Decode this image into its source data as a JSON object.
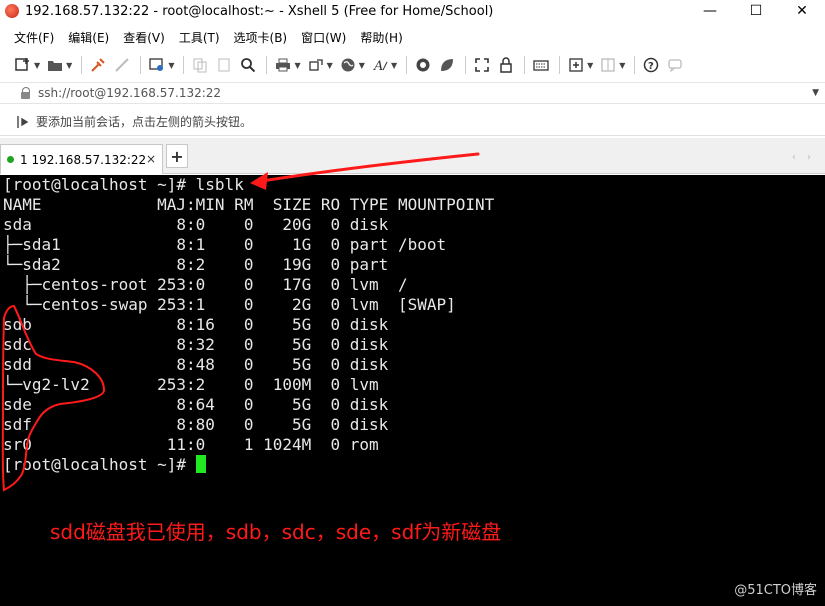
{
  "window": {
    "title": "192.168.57.132:22 - root@localhost:~ - Xshell 5 (Free for Home/School)",
    "minimize": "—",
    "maximize": "☐",
    "close": "✕"
  },
  "menu": {
    "items": [
      "文件(F)",
      "编辑(E)",
      "查看(V)",
      "工具(T)",
      "选项卡(B)",
      "窗口(W)",
      "帮助(H)"
    ]
  },
  "address": {
    "text": "ssh://root@192.168.57.132:22"
  },
  "hint": {
    "text": "要添加当前会话，点击左侧的箭头按钮。"
  },
  "tabs": {
    "active_label": "1 192.168.57.132:22",
    "close": "×",
    "add": "+",
    "nav": "‹ ›"
  },
  "terminal": {
    "lines": [
      "[root@localhost ~]# lsblk",
      "NAME            MAJ:MIN RM  SIZE RO TYPE MOUNTPOINT",
      "sda               8:0    0   20G  0 disk",
      "├─sda1            8:1    0    1G  0 part /boot",
      "└─sda2            8:2    0   19G  0 part",
      "  ├─centos-root 253:0    0   17G  0 lvm  /",
      "  └─centos-swap 253:1    0    2G  0 lvm  [SWAP]",
      "sdb               8:16   0    5G  0 disk",
      "sdc               8:32   0    5G  0 disk",
      "sdd               8:48   0    5G  0 disk",
      "└─vg2-lv2       253:2    0  100M  0 lvm",
      "sde               8:64   0    5G  0 disk",
      "sdf               8:80   0    5G  0 disk",
      "sr0              11:0    1 1024M  0 rom"
    ],
    "prompt": "[root@localhost ~]# ",
    "cursor_color": "#22e822"
  },
  "annotation": {
    "note": "sdd磁盘我已使用，sdb，sdc，sde，sdf为新磁盘",
    "color": "#ff1a1a"
  },
  "watermark": "@51CTO博客"
}
